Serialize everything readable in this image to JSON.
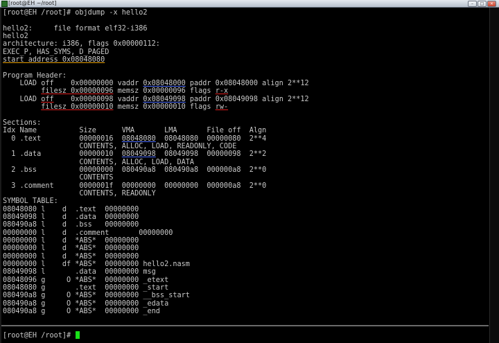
{
  "window": {
    "title": "[root@EH ~/root]"
  },
  "terminal": {
    "lines": [
      [
        {
          "t": "[root@EH /root]# objdump -x hello2"
        }
      ],
      [
        {
          "t": ""
        }
      ],
      [
        {
          "t": "hello2:     file format elf32-i386"
        }
      ],
      [
        {
          "t": "hello2"
        }
      ],
      [
        {
          "t": "architecture: i386, flags 0x00000112:"
        }
      ],
      [
        {
          "t": "EXEC_P, HAS_SYMS, D_PAGED"
        }
      ],
      [
        {
          "t": "start address 0x08048080",
          "u": "orange"
        }
      ],
      [
        {
          "t": ""
        }
      ],
      [
        {
          "t": "Program Header:"
        }
      ],
      [
        {
          "t": "    LOAD off    0x00000000 vaddr "
        },
        {
          "t": "0x08048000",
          "u": "blue"
        },
        {
          "t": " paddr 0x08048000 align 2**12"
        }
      ],
      [
        {
          "t": "         "
        },
        {
          "t": "filesz 0x00000096",
          "u": "red"
        },
        {
          "t": " memsz 0x00000096 flags "
        },
        {
          "t": "r-x",
          "u": "red"
        }
      ],
      [
        {
          "t": "    LOAD "
        },
        {
          "t": "off",
          "u": "red"
        },
        {
          "t": "    0x00000098 vaddr "
        },
        {
          "t": "0x08049098",
          "u": "blue"
        },
        {
          "t": " paddr 0x08049098 align 2**12"
        }
      ],
      [
        {
          "t": "         "
        },
        {
          "t": "filesz 0x00000010",
          "u": "red"
        },
        {
          "t": " memsz 0x00000010 flags "
        },
        {
          "t": "rw-",
          "u": "red"
        }
      ],
      [
        {
          "t": ""
        }
      ],
      [
        {
          "t": "Sections:"
        }
      ],
      [
        {
          "t": "Idx Name          Size      VMA       LMA       File off  Algn"
        }
      ],
      [
        {
          "t": "  0 .text         00000016  "
        },
        {
          "t": "08048080",
          "u": "blue"
        },
        {
          "t": "  08048080  00000080  2**4"
        }
      ],
      [
        {
          "t": "                  CONTENTS, ALLOC, LOAD, READONLY, CODE"
        }
      ],
      [
        {
          "t": "  1 .data         00000010  "
        },
        {
          "t": "08049098",
          "u": "blue"
        },
        {
          "t": "  08049098  00000098  2**2"
        }
      ],
      [
        {
          "t": "                  CONTENTS, ALLOC, LOAD, DATA"
        }
      ],
      [
        {
          "t": "  2 .bss          00000000  080490a8  080490a8  000000a8  2**0"
        }
      ],
      [
        {
          "t": "                  CONTENTS"
        }
      ],
      [
        {
          "t": "  3 .comment      0000001f  00000000  00000000  000000a8  2**0"
        }
      ],
      [
        {
          "t": "                  CONTENTS, READONLY"
        }
      ],
      [
        {
          "t": "SYMBOL TABLE:"
        }
      ],
      [
        {
          "t": "08048080 l    d  .text  00000000"
        }
      ],
      [
        {
          "t": "08049098 l    d  .data  00000000"
        }
      ],
      [
        {
          "t": "080490a8 l    d  .bss   00000000"
        }
      ],
      [
        {
          "t": "00000000 l    d  .comment       00000000"
        }
      ],
      [
        {
          "t": "00000000 l    d  *ABS*  00000000"
        }
      ],
      [
        {
          "t": "00000000 l    d  *ABS*  00000000"
        }
      ],
      [
        {
          "t": "00000000 l    d  *ABS*  00000000"
        }
      ],
      [
        {
          "t": "00000000 l    df *ABS*  00000000 hello2.nasm"
        }
      ],
      [
        {
          "t": "08049098 l       .data  00000000 msg"
        }
      ],
      [
        {
          "t": "08048096 g     O *ABS*  00000000 _etext"
        }
      ],
      [
        {
          "t": "08048080 g       .text  00000000 _start"
        }
      ],
      [
        {
          "t": "080490a8 g     O *ABS*  00000000 __bss_start"
        }
      ],
      [
        {
          "t": "080490a8 g     O *ABS*  00000000 _edata"
        }
      ],
      [
        {
          "t": "080490a8 g     O *ABS*  00000000 _end"
        }
      ]
    ]
  },
  "prompt": {
    "text": "[root@EH /root]# "
  },
  "colors": {
    "background": "#000000",
    "text": "#c9c9c9",
    "cursor": "#18e018",
    "underline_orange": "#e8a000",
    "underline_blue": "#4a6bff",
    "underline_red": "#e42020"
  }
}
